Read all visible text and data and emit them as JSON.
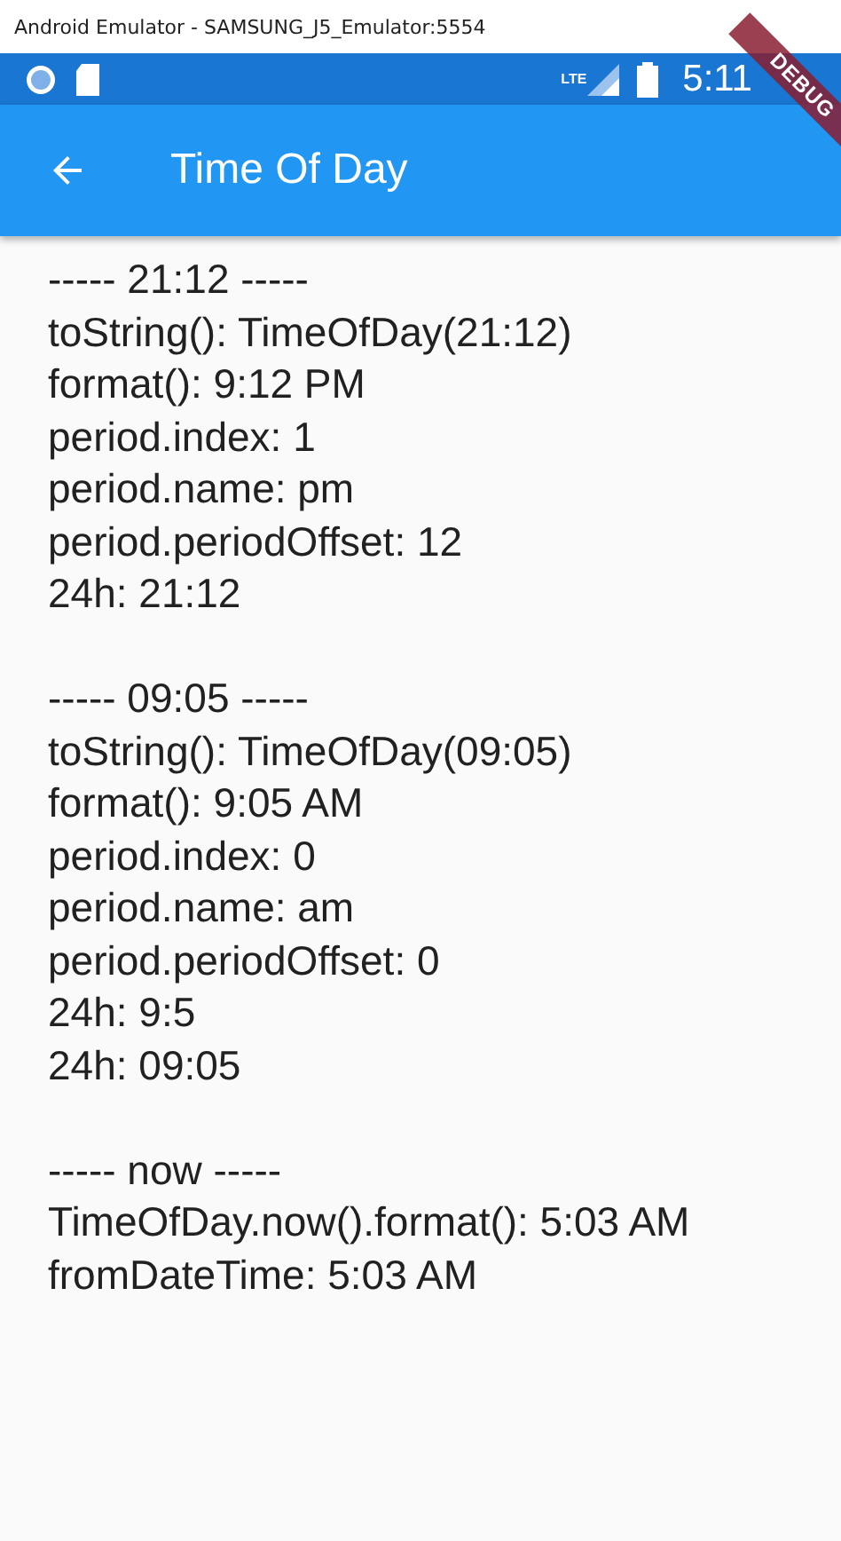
{
  "window": {
    "title": "Android Emulator - SAMSUNG_J5_Emulator:5554"
  },
  "status_bar": {
    "network": "LTE",
    "time": "5:11"
  },
  "debug_banner": "DEBUG",
  "app_bar": {
    "title": "Time Of Day"
  },
  "sections": [
    {
      "lines": [
        "----- 21:12 -----",
        "toString(): TimeOfDay(21:12)",
        "format(): 9:12 PM",
        "period.index: 1",
        "period.name: pm",
        "period.periodOffset: 12",
        "24h: 21:12"
      ]
    },
    {
      "lines": [
        "----- 09:05 -----",
        "toString(): TimeOfDay(09:05)",
        "format(): 9:05 AM",
        "period.index: 0",
        "period.name: am",
        "period.periodOffset: 0",
        "24h: 9:5",
        "24h: 09:05"
      ]
    },
    {
      "lines": [
        "----- now -----",
        "TimeOfDay.now().format(): 5:03 AM",
        "fromDateTime: 5:03 AM"
      ]
    }
  ]
}
